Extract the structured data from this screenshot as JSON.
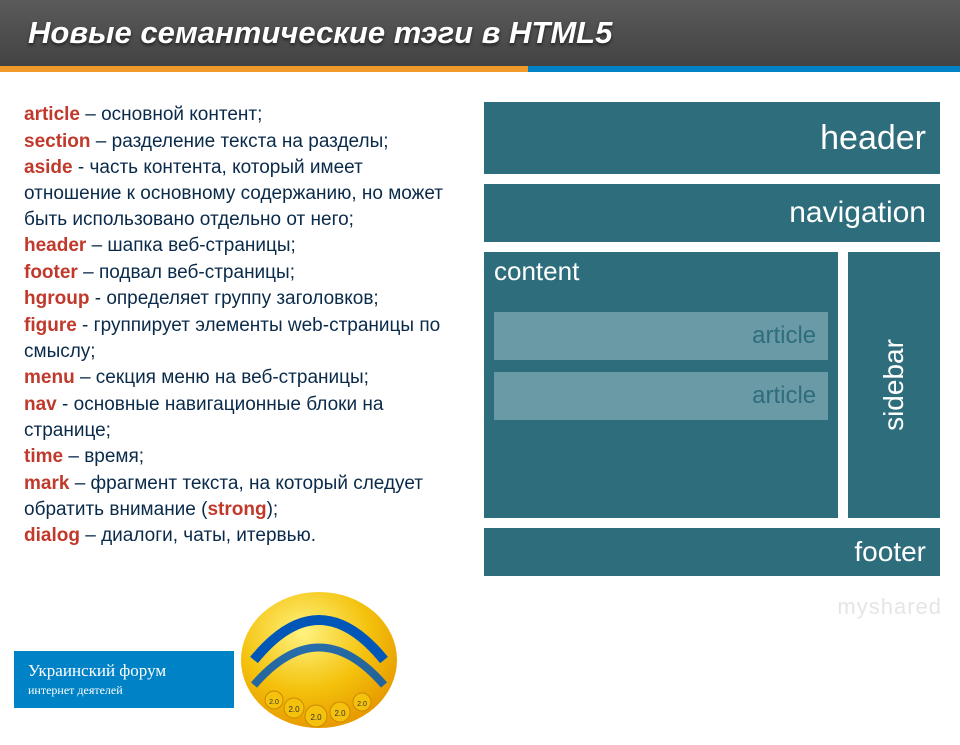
{
  "title": "Новые семантические тэги в HTML5",
  "definitions": [
    {
      "tag": "article",
      "desc": " – основной контент;"
    },
    {
      "tag": "section",
      "desc": " – разделение текста на разделы;"
    },
    {
      "tag": "aside",
      "desc": " - часть контента, который имеет отношение к основному содержанию, но может быть использовано отдельно от него;"
    },
    {
      "tag": "header",
      "desc": " – шапка веб-страницы;"
    },
    {
      "tag": "footer",
      "desc": " – подвал веб-страницы;"
    },
    {
      "tag": "hgroup",
      "desc": " - определяет группу заголовков;"
    },
    {
      "tag": "figure",
      "desc": " - группирует элементы web-страницы по смыслу;"
    },
    {
      "tag": "menu",
      "desc": " – секция меню на веб-страницы;"
    },
    {
      "tag": "nav",
      "desc": " - основные навигационные блоки на странице;"
    },
    {
      "tag": "time",
      "desc": " – время;"
    },
    {
      "tag": "mark",
      "desc": " – фрагмент текста, на который следует обратить внимание (",
      "emph": "strong",
      "desc2": ");"
    },
    {
      "tag": "dialog",
      "desc": " – диалоги, чаты, итервью."
    }
  ],
  "diagram": {
    "header": "header",
    "navigation": "navigation",
    "content": "content",
    "article1": "article",
    "article2": "article",
    "sidebar": "sidebar",
    "footer": "footer"
  },
  "brand": {
    "line1": "Украинский форум",
    "line2": "интернет деятелей"
  },
  "watermark": "myshared"
}
